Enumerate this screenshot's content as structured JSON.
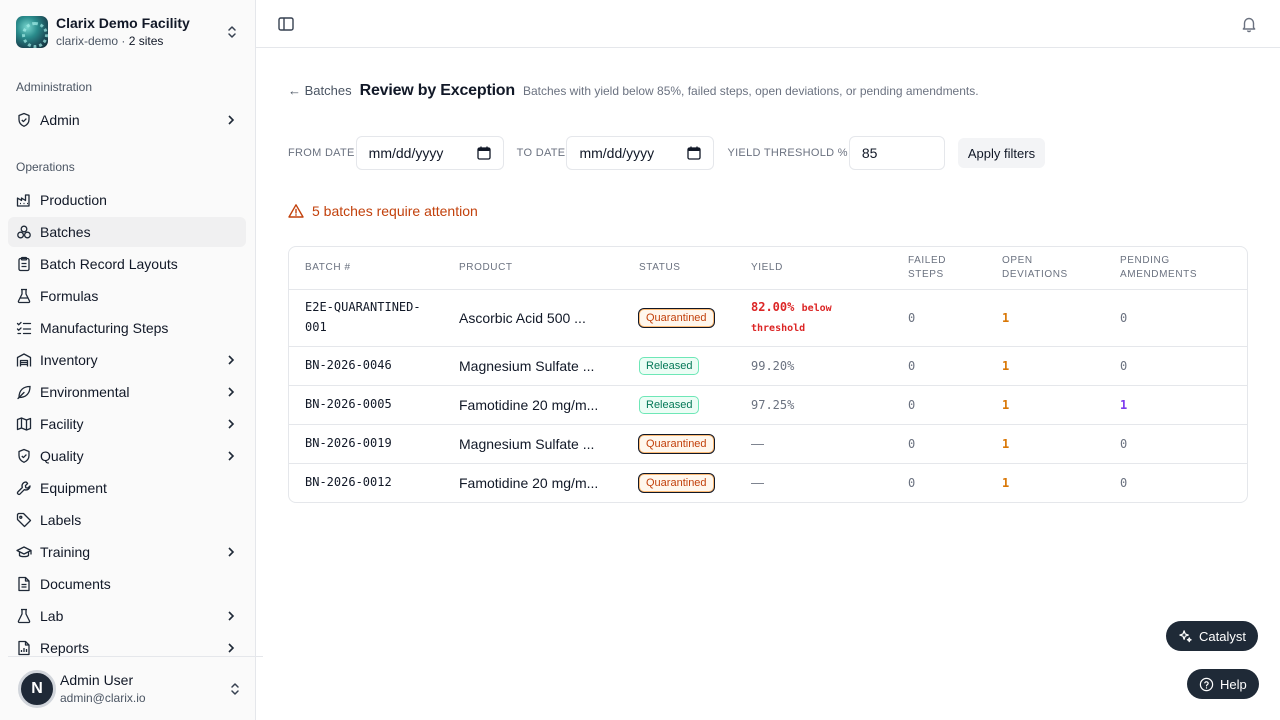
{
  "org": {
    "name": "Clarix Demo Facility",
    "slug": "clarix-demo",
    "sites": "2 sites",
    "separator": "·"
  },
  "sidebar": {
    "admin_section": "Administration",
    "admin_item": "Admin",
    "ops_section": "Operations",
    "items": [
      {
        "label": "Production"
      },
      {
        "label": "Batches"
      },
      {
        "label": "Batch Record Layouts"
      },
      {
        "label": "Formulas"
      },
      {
        "label": "Manufacturing Steps"
      },
      {
        "label": "Inventory"
      },
      {
        "label": "Environmental"
      },
      {
        "label": "Facility"
      },
      {
        "label": "Quality"
      },
      {
        "label": "Equipment"
      },
      {
        "label": "Labels"
      },
      {
        "label": "Training"
      },
      {
        "label": "Documents"
      },
      {
        "label": "Lab"
      },
      {
        "label": "Reports"
      }
    ]
  },
  "user": {
    "initial": "N",
    "name": "Admin User",
    "email": "admin@clarix.io"
  },
  "header": {
    "back": "← Batches",
    "title": "Review by Exception",
    "description": "Batches with yield below 85%, failed steps, open deviations, or pending amendments."
  },
  "filters": {
    "from_label": "FROM DATE",
    "from_value": "mm/dd/yyyy",
    "to_label": "TO DATE",
    "to_value": "mm/dd/yyyy",
    "threshold_label": "YIELD THRESHOLD %",
    "threshold_value": "85",
    "apply": "Apply filters"
  },
  "alert": "5 batches require attention",
  "table": {
    "headers": {
      "batch": "BATCH #",
      "product": "PRODUCT",
      "status": "STATUS",
      "yield": "YIELD",
      "failed_1": "FAILED",
      "failed_2": "STEPS",
      "open_1": "OPEN",
      "open_2": "DEVIATIONS",
      "pending_1": "PENDING",
      "pending_2": "AMENDMENTS"
    },
    "rows": [
      {
        "batch_1": "E2E-QUARANTINED-",
        "batch_2": "001",
        "product": "Ascorbic Acid 500 ...",
        "status": "Quarantined",
        "yield": "82.00%",
        "yield_note_1": "below",
        "yield_note_2": "threshold",
        "failed": "0",
        "deviations": "1",
        "amendments": "0"
      },
      {
        "batch": "BN-2026-0046",
        "product": "Magnesium Sulfate ...",
        "status": "Released",
        "yield": "99.20%",
        "failed": "0",
        "deviations": "1",
        "amendments": "0"
      },
      {
        "batch": "BN-2026-0005",
        "product": "Famotidine 20 mg/m...",
        "status": "Released",
        "yield": "97.25%",
        "failed": "0",
        "deviations": "1",
        "amendments": "1"
      },
      {
        "batch": "BN-2026-0019",
        "product": "Magnesium Sulfate ...",
        "status": "Quarantined",
        "yield": "—",
        "failed": "0",
        "deviations": "1",
        "amendments": "0"
      },
      {
        "batch": "BN-2026-0012",
        "product": "Famotidine 20 mg/m...",
        "status": "Quarantined",
        "yield": "—",
        "failed": "0",
        "deviations": "1",
        "amendments": "0"
      }
    ]
  },
  "fab": {
    "catalyst": "Catalyst",
    "help": "Help"
  },
  "colors": {
    "alert": "#c2410c",
    "quarantined": "#c2410c",
    "released": "#047857",
    "deviation": "#d97706",
    "amendment": "#7c3aed",
    "yield_fail": "#dc2626"
  }
}
